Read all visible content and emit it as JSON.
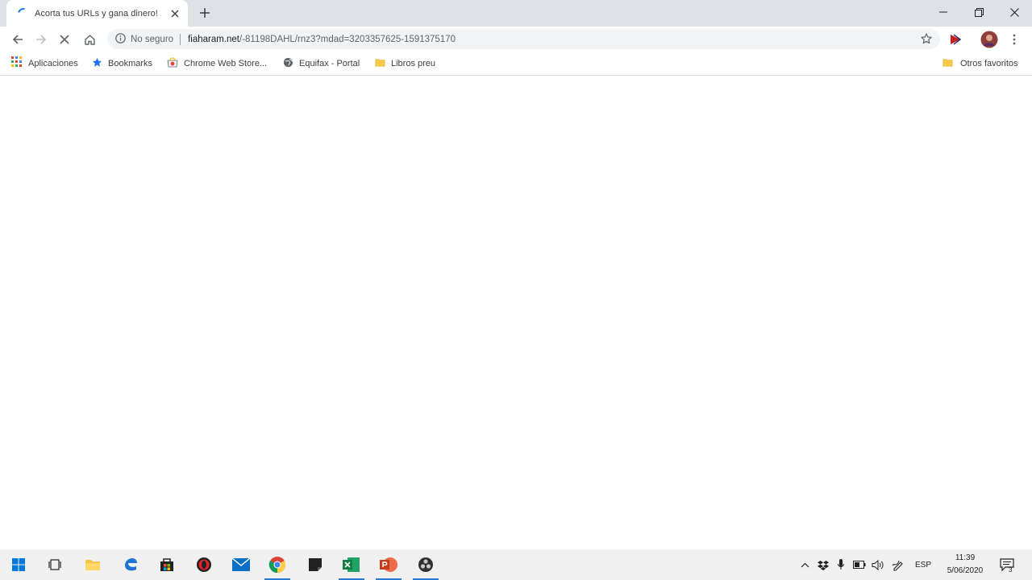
{
  "browser": {
    "tab": {
      "title": "Acorta tus URLs y gana dinero!"
    },
    "window_controls": [
      "minimize",
      "restore",
      "close"
    ],
    "omnibox": {
      "security_label": "No seguro",
      "url_domain": "fiaharam.net",
      "url_rest": "/-81198DAHL/rnz3?mdad=3203357625-1591375170"
    },
    "bookmarks": [
      {
        "label": "Aplicaciones",
        "icon": "apps-grid-icon"
      },
      {
        "label": "Bookmarks",
        "icon": "star-bookmark-icon"
      },
      {
        "label": "Chrome Web Store...",
        "icon": "webstore-icon"
      },
      {
        "label": "Equifax - Portal",
        "icon": "globe-icon"
      },
      {
        "label": "Libros preu",
        "icon": "folder-icon"
      }
    ],
    "other_bookmarks": "Otros favoritos"
  },
  "taskbar": {
    "apps": [
      "windows-start",
      "task-view",
      "file-explorer",
      "edge",
      "store",
      "opera",
      "mail",
      "chrome",
      "sticky-notes",
      "excel",
      "powerpoint",
      "obs"
    ],
    "language": "ESP",
    "time": "11:39",
    "date": "5/06/2020",
    "notification_count": "3"
  },
  "colors": {
    "tabstrip": "#dee1e6",
    "accent": "#1a73e8",
    "taskbar": "#f0f0f0"
  }
}
